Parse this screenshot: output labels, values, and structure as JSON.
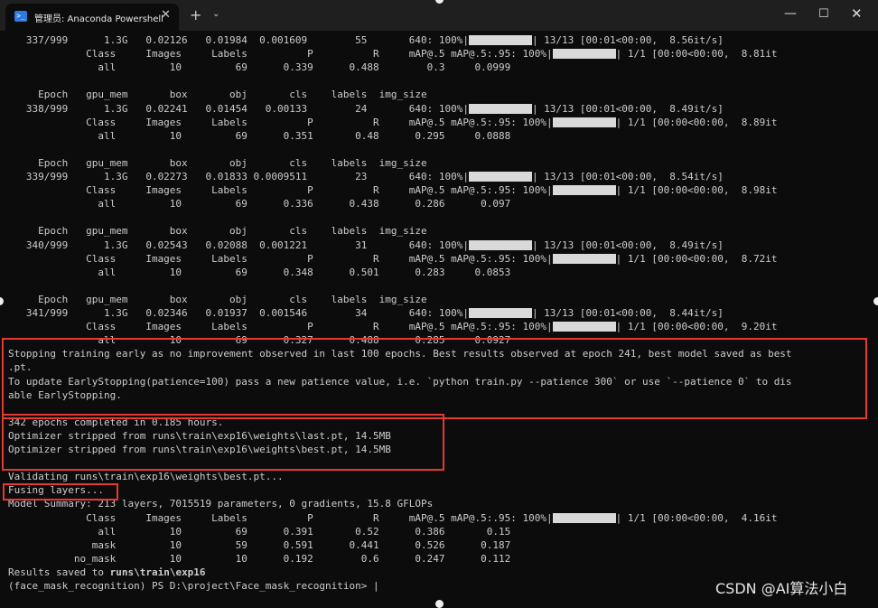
{
  "window": {
    "tab_title": "管理员: Anaconda Powershell",
    "tab_icon_glyph": ">_",
    "tab_close_glyph": "✕",
    "new_tab_glyph": "+",
    "dropdown_glyph": "⌄",
    "minimize_glyph": "—",
    "maximize_glyph": "☐",
    "close_glyph": "✕"
  },
  "terminal": {
    "bg_color": "#0c0c0c",
    "fg_color": "#cccccc",
    "highlight_color": "#e53935",
    "lines": [
      {
        "pre": "   337/999      1.3G   0.02126   0.01984  0.001609        55       640: 100%|",
        "bar": true,
        "post": "| 13/13 [00:01<00:00,  8.56it/s]"
      },
      {
        "pre": "             Class     Images     Labels          P          R     mAP@.5 mAP@.5:.95: 100%|",
        "bar": true,
        "post": "| 1/1 [00:00<00:00,  8.81it"
      },
      {
        "pre": "               all         10         69      0.339      0.488        0.3     0.0999",
        "bar": false,
        "post": ""
      },
      {
        "pre": "",
        "bar": false,
        "post": ""
      },
      {
        "pre": "     Epoch   gpu_mem       box       obj       cls    labels  img_size",
        "bar": false,
        "post": ""
      },
      {
        "pre": "   338/999      1.3G   0.02241   0.01454   0.00133        24       640: 100%|",
        "bar": true,
        "post": "| 13/13 [00:01<00:00,  8.49it/s]"
      },
      {
        "pre": "             Class     Images     Labels          P          R     mAP@.5 mAP@.5:.95: 100%|",
        "bar": true,
        "post": "| 1/1 [00:00<00:00,  8.89it"
      },
      {
        "pre": "               all         10         69      0.351       0.48      0.295     0.0888",
        "bar": false,
        "post": ""
      },
      {
        "pre": "",
        "bar": false,
        "post": ""
      },
      {
        "pre": "     Epoch   gpu_mem       box       obj       cls    labels  img_size",
        "bar": false,
        "post": ""
      },
      {
        "pre": "   339/999      1.3G   0.02273   0.01833 0.0009511        23       640: 100%|",
        "bar": true,
        "post": "| 13/13 [00:01<00:00,  8.54it/s]"
      },
      {
        "pre": "             Class     Images     Labels          P          R     mAP@.5 mAP@.5:.95: 100%|",
        "bar": true,
        "post": "| 1/1 [00:00<00:00,  8.98it"
      },
      {
        "pre": "               all         10         69      0.336      0.438      0.286      0.097",
        "bar": false,
        "post": ""
      },
      {
        "pre": "",
        "bar": false,
        "post": ""
      },
      {
        "pre": "     Epoch   gpu_mem       box       obj       cls    labels  img_size",
        "bar": false,
        "post": ""
      },
      {
        "pre": "   340/999      1.3G   0.02543   0.02088  0.001221        31       640: 100%|",
        "bar": true,
        "post": "| 13/13 [00:01<00:00,  8.49it/s]"
      },
      {
        "pre": "             Class     Images     Labels          P          R     mAP@.5 mAP@.5:.95: 100%|",
        "bar": true,
        "post": "| 1/1 [00:00<00:00,  8.72it"
      },
      {
        "pre": "               all         10         69      0.348      0.501      0.283     0.0853",
        "bar": false,
        "post": ""
      },
      {
        "pre": "",
        "bar": false,
        "post": ""
      },
      {
        "pre": "     Epoch   gpu_mem       box       obj       cls    labels  img_size",
        "bar": false,
        "post": ""
      },
      {
        "pre": "   341/999      1.3G   0.02346   0.01937  0.001546        34       640: 100%|",
        "bar": true,
        "post": "| 13/13 [00:01<00:00,  8.44it/s]"
      },
      {
        "pre": "             Class     Images     Labels          P          R     mAP@.5 mAP@.5:.95: 100%|",
        "bar": true,
        "post": "| 1/1 [00:00<00:00,  9.20it"
      },
      {
        "pre": "               all         10         69      0.327      0.488      0.285     0.0927",
        "bar": false,
        "post": ""
      },
      {
        "pre": "Stopping training early as no improvement observed in last 100 epochs. Best results observed at epoch 241, best model saved as best",
        "bar": false,
        "post": ""
      },
      {
        "pre": ".pt.",
        "bar": false,
        "post": ""
      },
      {
        "pre": "To update EarlyStopping(patience=100) pass a new patience value, i.e. `python train.py --patience 300` or use `--patience 0` to dis",
        "bar": false,
        "post": ""
      },
      {
        "pre": "able EarlyStopping.",
        "bar": false,
        "post": ""
      },
      {
        "pre": "",
        "bar": false,
        "post": ""
      },
      {
        "pre": "342 epochs completed in 0.185 hours.",
        "bar": false,
        "post": ""
      },
      {
        "pre": "Optimizer stripped from runs\\train\\exp16\\weights\\last.pt, 14.5MB",
        "bar": false,
        "post": ""
      },
      {
        "pre": "Optimizer stripped from runs\\train\\exp16\\weights\\best.pt, 14.5MB",
        "bar": false,
        "post": ""
      },
      {
        "pre": "",
        "bar": false,
        "post": ""
      },
      {
        "pre": "Validating runs\\train\\exp16\\weights\\best.pt...",
        "bar": false,
        "post": ""
      },
      {
        "pre": "Fusing layers...",
        "bar": false,
        "post": ""
      },
      {
        "pre": "Model Summary: 213 layers, 7015519 parameters, 0 gradients, 15.8 GFLOPs",
        "bar": false,
        "post": ""
      },
      {
        "pre": "             Class     Images     Labels          P          R     mAP@.5 mAP@.5:.95: 100%|",
        "bar": true,
        "post": "| 1/1 [00:00<00:00,  4.16it"
      },
      {
        "pre": "               all         10         69      0.391       0.52      0.386       0.15",
        "bar": false,
        "post": ""
      },
      {
        "pre": "              mask         10         59      0.591      0.441      0.526      0.187",
        "bar": false,
        "post": ""
      },
      {
        "pre": "           no_mask         10         10      0.192        0.6      0.247      0.112",
        "bar": false,
        "post": ""
      },
      {
        "pre": "Results saved to ",
        "bar": false,
        "post": "",
        "bold": "runs\\train\\exp16"
      },
      {
        "pre": "(face_mask_recognition) PS D:\\project\\Face_mask_recognition> |",
        "bar": false,
        "post": ""
      }
    ]
  },
  "watermark": "CSDN @AI算法小白"
}
